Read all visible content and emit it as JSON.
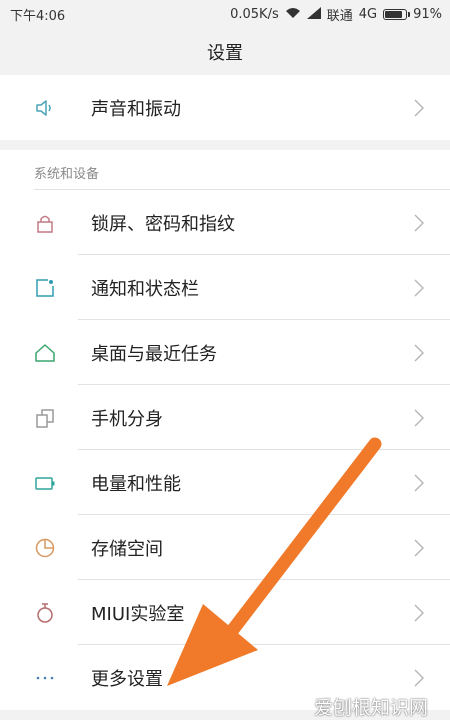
{
  "status_bar": {
    "time": "下午4:06",
    "speed": "0.05K/s",
    "carrier": "联通",
    "network": "4G",
    "battery_percent": "91%",
    "battery_level": 0.91
  },
  "header": {
    "title": "设置"
  },
  "top_items": [
    {
      "label": "声音和振动",
      "icon": "speaker-icon",
      "color": "#4aa3b8"
    }
  ],
  "section": {
    "title": "系统和设备",
    "items": [
      {
        "label": "锁屏、密码和指纹",
        "icon": "lock-icon",
        "color": "#c47a86"
      },
      {
        "label": "通知和状态栏",
        "icon": "notification-icon",
        "color": "#2f9db1"
      },
      {
        "label": "桌面与最近任务",
        "icon": "home-icon",
        "color": "#3aa66e"
      },
      {
        "label": "手机分身",
        "icon": "clone-icon",
        "color": "#9a9a9a"
      },
      {
        "label": "电量和性能",
        "icon": "battery-icon",
        "color": "#2fa59a"
      },
      {
        "label": "存储空间",
        "icon": "storage-pie-icon",
        "color": "#d89860"
      },
      {
        "label": "MIUI实验室",
        "icon": "flask-icon",
        "color": "#b56c6c"
      },
      {
        "label": "更多设置",
        "icon": "more-dots-icon",
        "color": "#4a7fb5"
      }
    ]
  },
  "annotation": {
    "arrow_color": "#f07a2a"
  },
  "watermark": "爱刨根知识网"
}
